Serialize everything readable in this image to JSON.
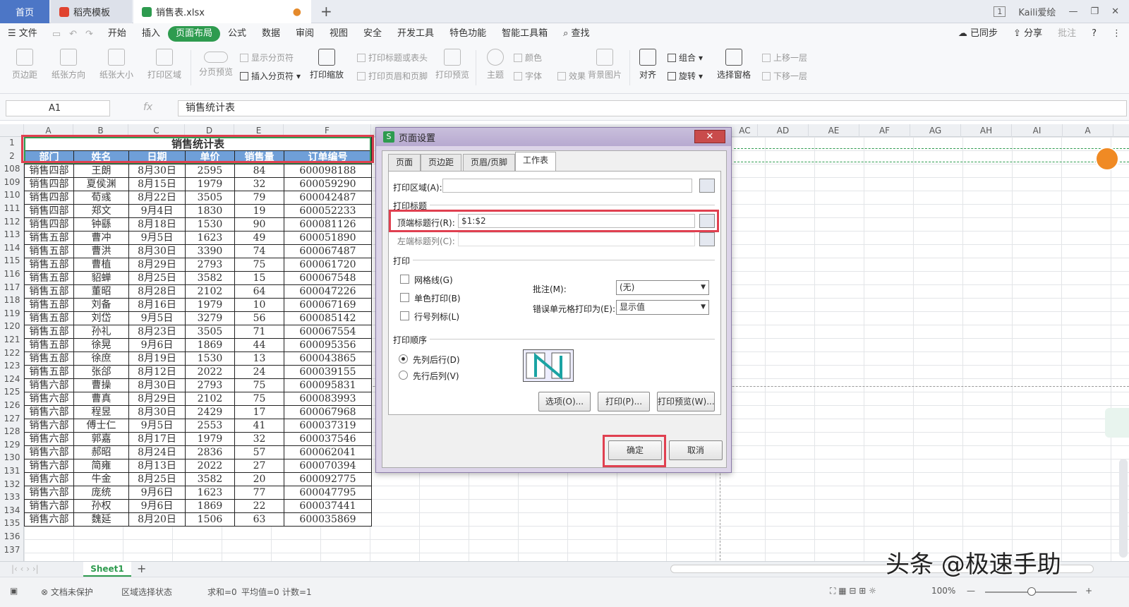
{
  "titlebar": {
    "tabs": [
      "首页",
      "稻壳模板",
      "销售表.xlsx"
    ],
    "badge": "1",
    "user": "Kaili爱绘"
  },
  "menu": {
    "file": "文件",
    "items": [
      "开始",
      "插入",
      "页面布局",
      "公式",
      "数据",
      "审阅",
      "视图",
      "安全",
      "开发工具",
      "特色功能",
      "智能工具箱"
    ],
    "active": "页面布局",
    "search": "查找",
    "sync": "已同步",
    "share": "分享",
    "comment": "批注"
  },
  "ribbon": {
    "b1": "页边距",
    "b2": "纸张方向",
    "b3": "纸张大小",
    "b4": "打印区域",
    "b5": "分页预览",
    "s1": "显示分页符",
    "s2": "插入分页符",
    "b6": "打印缩放",
    "s3": "打印标题或表头",
    "s4": "打印页眉和页脚",
    "b7": "打印预览",
    "b8": "主题",
    "s5": "颜色",
    "s6": "字体",
    "s7": "效果",
    "b9": "背景图片",
    "b10": "对齐",
    "s8": "组合",
    "s9": "旋转",
    "b11": "选择窗格",
    "s10": "上移一层",
    "s11": "下移一层"
  },
  "formula": {
    "cell": "A1",
    "fx": "fx",
    "value": "销售统计表"
  },
  "columns": [
    "A",
    "B",
    "C",
    "D",
    "E",
    "F",
    "AC",
    "AD",
    "AE",
    "AF",
    "AG",
    "AH",
    "AI",
    "A"
  ],
  "sheet": {
    "title": "销售统计表",
    "headers": [
      "部门",
      "姓名",
      "日期",
      "单价",
      "销售量",
      "订单编号"
    ],
    "rows": [
      [
        "108",
        "销售四部",
        "王朗",
        "8月30日",
        "2595",
        "84",
        "600098188"
      ],
      [
        "109",
        "销售四部",
        "夏侯渊",
        "8月15日",
        "1979",
        "32",
        "600059290"
      ],
      [
        "110",
        "销售四部",
        "荀彧",
        "8月22日",
        "3505",
        "79",
        "600042487"
      ],
      [
        "111",
        "销售四部",
        "郑文",
        "9月4日",
        "1830",
        "19",
        "600052233"
      ],
      [
        "112",
        "销售四部",
        "钟繇",
        "8月18日",
        "1530",
        "90",
        "600081126"
      ],
      [
        "113",
        "销售五部",
        "曹冲",
        "9月5日",
        "1623",
        "49",
        "600051890"
      ],
      [
        "114",
        "销售五部",
        "曹洪",
        "8月30日",
        "3390",
        "74",
        "600067487"
      ],
      [
        "115",
        "销售五部",
        "曹植",
        "8月29日",
        "2793",
        "75",
        "600061720"
      ],
      [
        "116",
        "销售五部",
        "貂蝉",
        "8月25日",
        "3582",
        "15",
        "600067548"
      ],
      [
        "117",
        "销售五部",
        "董昭",
        "8月28日",
        "2102",
        "64",
        "600047226"
      ],
      [
        "118",
        "销售五部",
        "刘备",
        "8月16日",
        "1979",
        "10",
        "600067169"
      ],
      [
        "119",
        "销售五部",
        "刘岱",
        "9月5日",
        "3279",
        "56",
        "600085142"
      ],
      [
        "120",
        "销售五部",
        "孙礼",
        "8月23日",
        "3505",
        "71",
        "600067554"
      ],
      [
        "121",
        "销售五部",
        "徐晃",
        "9月6日",
        "1869",
        "44",
        "600095356"
      ],
      [
        "122",
        "销售五部",
        "徐庶",
        "8月19日",
        "1530",
        "13",
        "600043865"
      ],
      [
        "123",
        "销售五部",
        "张郃",
        "8月12日",
        "2022",
        "24",
        "600039155"
      ],
      [
        "124",
        "销售六部",
        "曹操",
        "8月30日",
        "2793",
        "75",
        "600095831"
      ],
      [
        "125",
        "销售六部",
        "曹真",
        "8月29日",
        "2102",
        "75",
        "600083993"
      ],
      [
        "126",
        "销售六部",
        "程昱",
        "8月30日",
        "2429",
        "17",
        "600067968"
      ],
      [
        "127",
        "销售六部",
        "傅士仁",
        "9月5日",
        "2553",
        "41",
        "600037319"
      ],
      [
        "128",
        "销售六部",
        "郭嘉",
        "8月17日",
        "1979",
        "32",
        "600037546"
      ],
      [
        "129",
        "销售六部",
        "郝昭",
        "8月24日",
        "2836",
        "57",
        "600062041"
      ],
      [
        "130",
        "销售六部",
        "简雍",
        "8月13日",
        "2022",
        "27",
        "600070394"
      ],
      [
        "131",
        "销售六部",
        "牛金",
        "8月25日",
        "3582",
        "20",
        "600092775"
      ],
      [
        "132",
        "销售六部",
        "庞统",
        "9月6日",
        "1623",
        "77",
        "600047795"
      ],
      [
        "133",
        "销售六部",
        "孙权",
        "9月6日",
        "1869",
        "22",
        "600037441"
      ],
      [
        "134",
        "销售六部",
        "魏延",
        "8月20日",
        "1506",
        "63",
        "600035869"
      ]
    ],
    "empty_rows": [
      "135",
      "136",
      "137"
    ]
  },
  "dialog": {
    "title": "页面设置",
    "close": "✕",
    "tabs": [
      "页面",
      "页边距",
      "页眉/页脚",
      "工作表"
    ],
    "active_tab": "工作表",
    "print_area_label": "打印区域(A):",
    "print_title": "打印标题",
    "top_rows_label": "顶端标题行(R):",
    "top_rows_value": "$1:$2",
    "left_cols_label": "左端标题列(C):",
    "print_section": "打印",
    "gridlines": "网格线(G)",
    "mono": "单色打印(B)",
    "rowcol": "行号列标(L)",
    "comments_label": "批注(M):",
    "comments_value": "(无)",
    "errors_label": "错误单元格打印为(E):",
    "errors_value": "显示值",
    "order_section": "打印顺序",
    "order1": "先列后行(D)",
    "order2": "先行后列(V)",
    "btn_options": "选项(O)...",
    "btn_print": "打印(P)...",
    "btn_preview": "打印预览(W)...",
    "btn_ok": "确定",
    "btn_cancel": "取消"
  },
  "sheettab": "Sheet1",
  "status": {
    "protect": "文档未保护",
    "mode": "区域选择状态",
    "sum": "求和=0",
    "avg": "平均值=0",
    "count": "计数=1",
    "zoom": "100%"
  },
  "watermark": "头条 @极速手助"
}
